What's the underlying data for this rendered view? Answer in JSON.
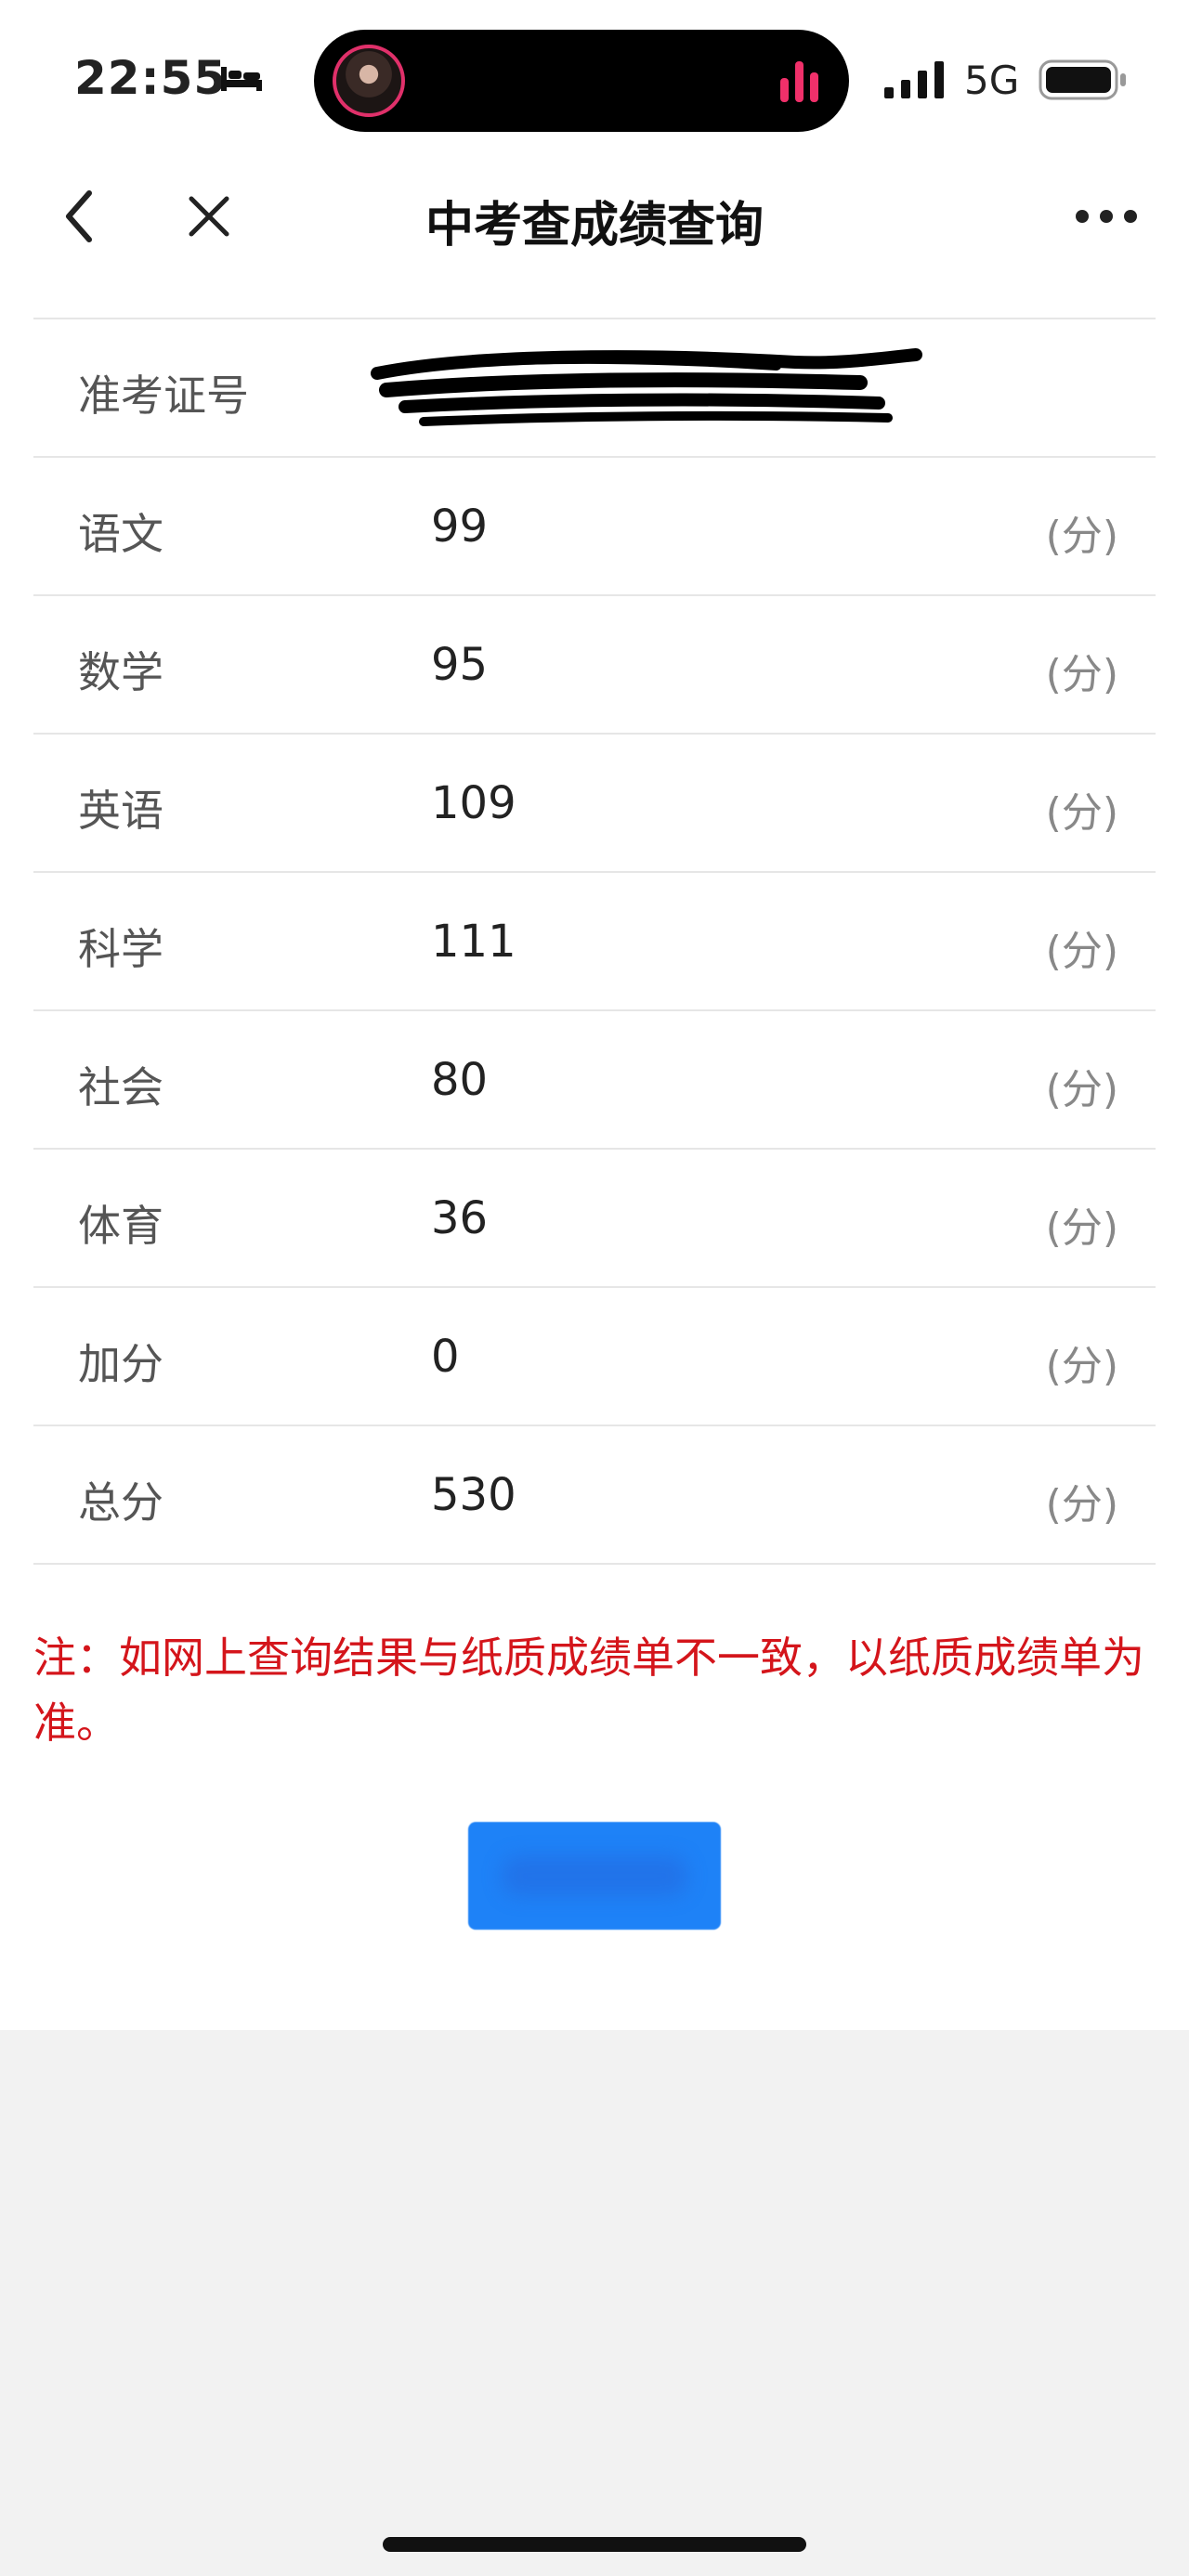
{
  "status_bar": {
    "time": "22:55",
    "network": "5G",
    "icons": [
      "bed-icon",
      "signal-icon",
      "battery-icon",
      "audio-bars-icon"
    ]
  },
  "nav": {
    "title": "中考查成绩查询",
    "icons": [
      "back-icon",
      "close-icon",
      "more-icon"
    ]
  },
  "table": {
    "id_label": "准考证号",
    "id_value": "",
    "unit": "(分)",
    "rows": [
      {
        "label": "语文",
        "value": "99"
      },
      {
        "label": "数学",
        "value": "95"
      },
      {
        "label": "英语",
        "value": "109"
      },
      {
        "label": "科学",
        "value": "111"
      },
      {
        "label": "社会",
        "value": "80"
      },
      {
        "label": "体育",
        "value": "36"
      },
      {
        "label": "加分",
        "value": "0"
      },
      {
        "label": "总分",
        "value": "530"
      }
    ]
  },
  "note": "注：如网上查询结果与纸质成绩单不一致，以纸质成绩单为准。",
  "button": {
    "label": ""
  },
  "colors": {
    "accent": "#1e82f7",
    "note_red": "#d4151b",
    "divider": "#e6e6e6",
    "bg_gray": "#f2f2f2"
  }
}
